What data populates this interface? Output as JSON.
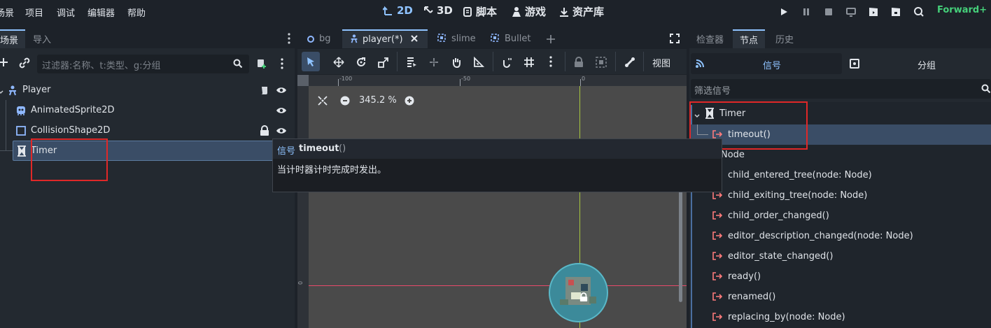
{
  "menu": [
    "场景",
    "项目",
    "调试",
    "编辑器",
    "帮助"
  ],
  "workspaces": [
    {
      "label": "2D",
      "icon": "2d-icon",
      "active": true
    },
    {
      "label": "3D",
      "icon": "3d-icon",
      "active": false
    },
    {
      "label": "脚本",
      "icon": "script-icon",
      "active": false
    },
    {
      "label": "游戏",
      "icon": "game-icon",
      "active": false
    },
    {
      "label": "资产库",
      "icon": "asset-library-icon",
      "active": false
    }
  ],
  "renderer": "Forward+",
  "left_dock": {
    "tabs": [
      "场景",
      "导入"
    ],
    "filter_placeholder": "过滤器:名称、t:类型、g:分组",
    "nodes": [
      {
        "name": "Player",
        "icon": "character-body-icon"
      },
      {
        "name": "AnimatedSprite2D",
        "icon": "animated-sprite-icon"
      },
      {
        "name": "CollisionShape2D",
        "icon": "collision-shape-icon"
      },
      {
        "name": "Timer",
        "icon": "timer-icon"
      }
    ]
  },
  "editor_tabs": [
    {
      "label": "bg",
      "active": false
    },
    {
      "label": "player(*)",
      "active": true
    },
    {
      "label": "slime",
      "active": false
    },
    {
      "label": "Bullet",
      "active": false
    }
  ],
  "toolbar": {
    "view_label": "视图"
  },
  "viewport": {
    "zoom": "345.2 %",
    "ruler_top": [
      "-100",
      "-50",
      "0"
    ],
    "ruler_left": [
      "0"
    ]
  },
  "tooltip": {
    "prefix": "信号",
    "name": "timeout",
    "parens": "()",
    "description": "当计时器计时完成时发出。"
  },
  "right_dock": {
    "tabs": [
      "检查器",
      "节点",
      "历史"
    ],
    "subtabs": [
      "信号",
      "分组"
    ],
    "filter_placeholder": "筛选信号",
    "timer_class": "Timer",
    "timer_signals": [
      "timeout()"
    ],
    "node_class": "Node",
    "node_signals": [
      "child_entered_tree(node: Node)",
      "child_exiting_tree(node: Node)",
      "child_order_changed()",
      "editor_description_changed(node: Node)",
      "editor_state_changed()",
      "ready()",
      "renamed()",
      "replacing_by(node: Node)"
    ]
  },
  "colors": {
    "accent": "#8fc3ff",
    "signal": "#ff7b7b",
    "highlight_box": "#e02828",
    "renderer": "#45d07a"
  }
}
